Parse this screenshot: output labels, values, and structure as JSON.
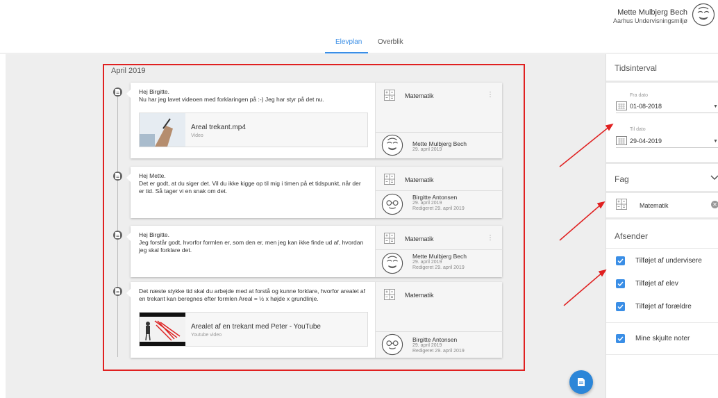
{
  "header": {
    "user_name": "Mette Mulbjerg Bech",
    "user_org": "Aarhus Undervisningsmiljø"
  },
  "tabs": [
    {
      "label": "Elevplan",
      "active": true
    },
    {
      "label": "Overblik",
      "active": false
    }
  ],
  "timeline": {
    "month": "April 2019",
    "entries": [
      {
        "text": "Hej Birgitte.\nNu har jeg lavet videoen med forklaringen på :-) Jeg har styr på det nu.",
        "attachment": {
          "title": "Areal trekant.mp4",
          "type": "Video"
        },
        "subject": "Matematik",
        "author": "Mette Mulbjerg Bech",
        "date": "29. april 2019",
        "edited": ""
      },
      {
        "text": "Hej Mette.\nDet er godt, at du siger det. Vil du ikke kigge op til mig i timen på et tidspunkt, når der er tid. Så tager vi en snak om det.",
        "subject": "Matematik",
        "author": "Birgitte Antonsen",
        "date": "29. april 2019",
        "edited": "Redigeret 29. april 2019"
      },
      {
        "text": "Hej Birgitte.\nJeg forstår godt, hvorfor formlen er, som den er, men jeg kan ikke finde ud af, hvordan jeg skal forklare det.",
        "subject": "Matematik",
        "author": "Mette Mulbjerg Bech",
        "date": "29. april 2019",
        "edited": "Redigeret 29. april 2019"
      },
      {
        "text": "Det næste stykke tid skal du arbejde med at forstå og kunne forklare, hvorfor arealet af en trekant kan beregnes efter formlen Areal = ½ x højde x grundlinje.",
        "attachment": {
          "title": "Arealet af en trekant med Peter - YouTube",
          "type": "Youtube video"
        },
        "subject": "Matematik",
        "author": "Birgitte Antonsen",
        "date": "29. april 2019",
        "edited": "Redigeret 29. april 2019"
      }
    ]
  },
  "panel": {
    "interval_title": "Tidsinterval",
    "from_label": "Fra dato",
    "from_value": "01-08-2018",
    "to_label": "Til dato",
    "to_value": "29-04-2019",
    "subject_title": "Fag",
    "subject_chip": "Matematik",
    "sender_title": "Afsender",
    "checkboxes": [
      {
        "label": "Tilføjet af undervisere",
        "checked": true
      },
      {
        "label": "Tilføjet af elev",
        "checked": true
      },
      {
        "label": "Tilføjet af forældre",
        "checked": true
      },
      {
        "label": "Mine skjulte noter",
        "checked": true
      }
    ]
  },
  "colors": {
    "accent": "#3a8ee6",
    "highlight": "#e02020",
    "fab": "#2c86d8"
  },
  "icons": {
    "kebab": "⋮",
    "chip_close": "✕"
  }
}
